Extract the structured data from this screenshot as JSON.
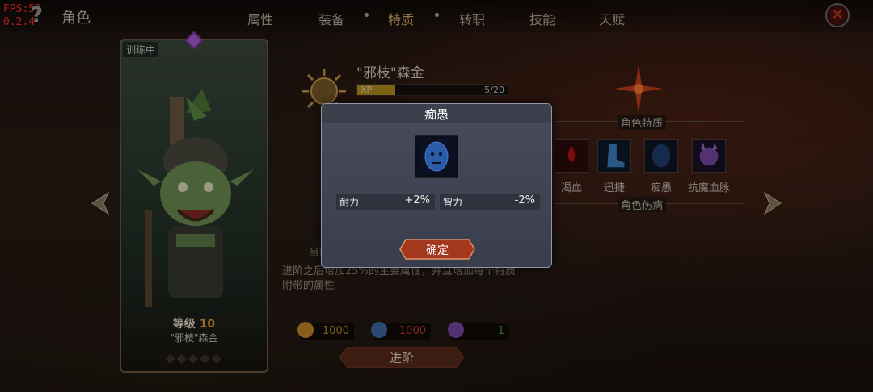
{
  "debug": {
    "fps": "FPS:59",
    "version": "0.2.4"
  },
  "header": {
    "title": "角色",
    "tabs": [
      {
        "label": "属性"
      },
      {
        "label": "装备"
      },
      {
        "label": "特质",
        "active": true
      },
      {
        "label": "转职"
      },
      {
        "label": "技能"
      },
      {
        "label": "天赋"
      }
    ]
  },
  "card": {
    "status_tag": "训练中",
    "level_label": "等级",
    "level_value": "10",
    "hero_name": "\"邪枝\"森金"
  },
  "hero": {
    "name": "\"邪枝\"森金",
    "xp_label": "XP",
    "xp_value": "5/20",
    "xp_fraction": 0.25
  },
  "traits": {
    "section_label": "角色特质",
    "disease_label": "角色伤病",
    "items": [
      {
        "name": "渴血",
        "icon": "blood-drop-icon"
      },
      {
        "name": "迅捷",
        "icon": "boot-icon"
      },
      {
        "name": "痴愚",
        "icon": "dull-face-icon"
      },
      {
        "name": "抗魔血脉",
        "icon": "demon-face-icon"
      }
    ]
  },
  "background_text": {
    "current_label": "当前",
    "after_label": "阶",
    "description": "进阶之后增加25%的主要属性，并且增加每个特质附带的属性"
  },
  "resources": [
    {
      "icon": "gold-coin-icon",
      "value": "1000",
      "color": "#c98a2a"
    },
    {
      "icon": "blue-crystal-icon",
      "value": "1000",
      "color": "#c0402a"
    },
    {
      "icon": "purple-crystal-icon",
      "value": "1",
      "color": "#4a9a3a"
    }
  ],
  "advance_button": "进阶",
  "dialog": {
    "title": "痴愚",
    "icon": "dull-face-icon",
    "stats": [
      {
        "name": "耐力",
        "value": "+2%"
      },
      {
        "name": "智力",
        "value": "-2%"
      }
    ],
    "confirm": "确定"
  },
  "colors": {
    "accent_gold": "#e0b36a",
    "xp_fill": "#b8921f",
    "dialog_bg": "#3f4252",
    "fps_red": "#ff2a2a"
  }
}
